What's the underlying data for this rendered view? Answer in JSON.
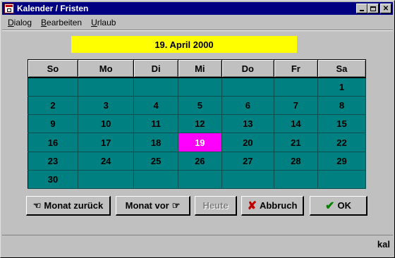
{
  "window": {
    "title": "Kalender / Fristen"
  },
  "menu": [
    {
      "label": "Dialog",
      "mnemonic": "D",
      "rest": "ialog"
    },
    {
      "label": "Bearbeiten",
      "mnemonic": "B",
      "rest": "earbeiten"
    },
    {
      "label": "Urlaub",
      "mnemonic": "U",
      "rest": "rlaub"
    }
  ],
  "selected_date": "19. April 2000",
  "calendar": {
    "weekdays": [
      "So",
      "Mo",
      "Di",
      "Mi",
      "Do",
      "Fr",
      "Sa"
    ],
    "weeks": [
      [
        "",
        "",
        "",
        "",
        "",
        "",
        "1"
      ],
      [
        "2",
        "3",
        "4",
        "5",
        "6",
        "7",
        "8"
      ],
      [
        "9",
        "10",
        "11",
        "12",
        "13",
        "14",
        "15"
      ],
      [
        "16",
        "17",
        "18",
        "19",
        "20",
        "21",
        "22"
      ],
      [
        "23",
        "24",
        "25",
        "26",
        "27",
        "28",
        "29"
      ],
      [
        "30",
        "",
        "",
        "",
        "",
        "",
        ""
      ]
    ],
    "today": "19",
    "colors": {
      "cell_bg": "#008080",
      "today_bg": "#ff00ff",
      "banner_bg": "#ffff00"
    }
  },
  "buttons": {
    "prev_month": "Monat zurück",
    "next_month": "Monat vor",
    "today": "Heute",
    "cancel": "Abbruch",
    "ok": "OK"
  },
  "status": "kal"
}
